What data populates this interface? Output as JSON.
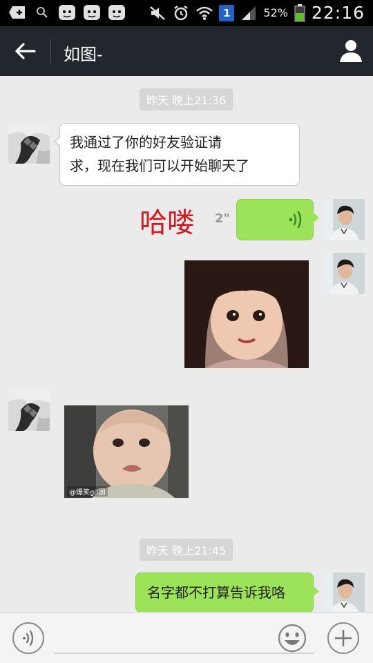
{
  "status_bar": {
    "battery_percent": "52%",
    "time": "22:16",
    "sim_badge": "1",
    "icons": [
      "add-box-icon",
      "search-icon",
      "app-face-icon",
      "app-face-icon",
      "app-face-icon",
      "mute-icon",
      "alarm-icon",
      "wifi-icon",
      "sim-badge-icon",
      "signal-icon",
      "battery-icon"
    ]
  },
  "header": {
    "title": "如图-",
    "back_icon": "arrow-left-icon",
    "profile_icon": "person-icon"
  },
  "chat": {
    "timestamps": [
      "昨天 晚上21:36",
      "昨天 晚上21:45"
    ],
    "messages": [
      {
        "side": "in",
        "type": "text",
        "text_line1": "我通过了你的好友验证请",
        "text_line2": "求，现在我们可以开始聊天了"
      },
      {
        "side": "out",
        "type": "voice",
        "duration": "2\"",
        "annotation": "哈喽"
      },
      {
        "side": "out",
        "type": "image",
        "subject": "smiling little girl"
      },
      {
        "side": "in",
        "type": "image",
        "subject": "crying baby gif",
        "watermark": "@爆笑gif图"
      },
      {
        "side": "out",
        "type": "text",
        "text": "名字都不打算告诉我咯"
      }
    ]
  },
  "input_bar": {
    "placeholder": "",
    "voice_icon": "voice-wave-icon",
    "emoji_icon": "smiley-icon",
    "plus_icon": "plus-icon"
  },
  "colors": {
    "header_bg": "#21272c",
    "chat_bg": "#ebebeb",
    "outgoing_bubble": "#9de35a",
    "annotation_red": "#d5171b"
  }
}
